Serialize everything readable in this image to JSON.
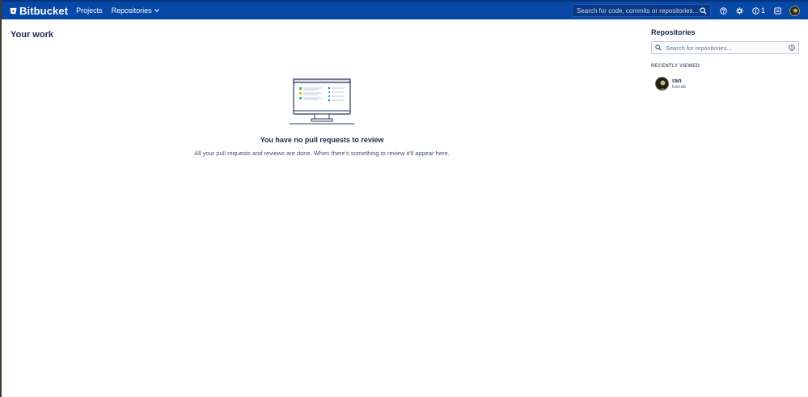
{
  "header": {
    "app_name": "Bitbucket",
    "nav": {
      "projects": "Projects",
      "repositories": "Repositories"
    },
    "search_placeholder": "Search for code, commits or repositories...",
    "notification_count": "1",
    "colors": {
      "bar": "#0747a6",
      "text": "#ffffff"
    }
  },
  "main": {
    "title": "Your work",
    "empty_state": {
      "title": "You have no pull requests to review",
      "description": "All your pull requests and reviews are done. When there's something to review it'll appear here."
    }
  },
  "sidebar": {
    "title": "Repositories",
    "search_placeholder": "Search for repositories...",
    "recent_label": "RECENTLY VIEWED",
    "recent": [
      {
        "name": "ran",
        "project": "kanak"
      }
    ]
  }
}
